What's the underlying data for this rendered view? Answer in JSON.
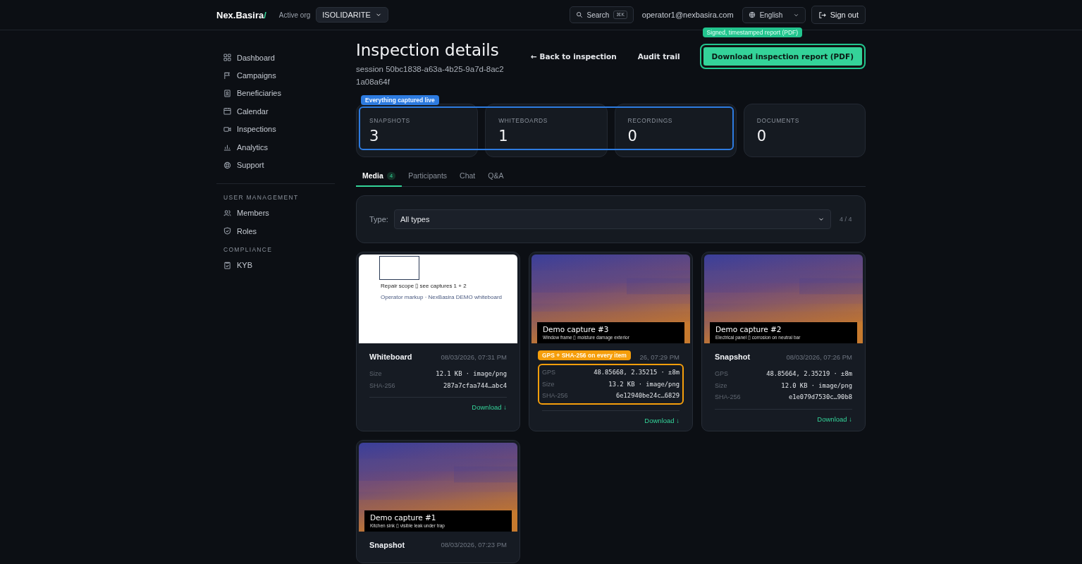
{
  "header": {
    "logo": {
      "name": "Nex.Basira",
      "mark": "/"
    },
    "org_label": "Active org",
    "org": "ISOLIDARITE",
    "search": {
      "label": "Search",
      "shortcut": "⌘K"
    },
    "user": "operator1@nexbasira.com",
    "language": "English",
    "sign_out": "Sign out"
  },
  "sidebar": {
    "items": [
      {
        "label": "Dashboard",
        "selected": false
      },
      {
        "label": "Campaigns",
        "selected": false
      },
      {
        "label": "Beneficiaries",
        "selected": false
      },
      {
        "label": "Calendar",
        "selected": false
      },
      {
        "label": "Inspections",
        "selected": false
      },
      {
        "label": "Analytics",
        "selected": false
      },
      {
        "label": "Support",
        "selected": false
      }
    ],
    "sections": [
      {
        "title": "USER MANAGEMENT",
        "items": [
          {
            "label": "Members",
            "selected": false
          },
          {
            "label": "Roles",
            "selected": false
          }
        ]
      },
      {
        "title": "COMPLIANCE",
        "items": [
          {
            "label": "KYB",
            "selected": false
          }
        ]
      }
    ]
  },
  "page": {
    "title": "Inspection details",
    "subtitle": "session 50bc1838-a63a-4b25-9a7d-8ac21a08a64f",
    "actions": {
      "back": "← Back to inspection",
      "audit": "Audit trail",
      "download": {
        "label": "Download inspection report (PDF)",
        "callout": "Signed, timestamped report (PDF)"
      }
    }
  },
  "stats": {
    "callout": "Everything captured live",
    "cards": [
      {
        "label": "SNAPSHOTS",
        "value": "3",
        "highlighted": true
      },
      {
        "label": "WHITEBOARDS",
        "value": "1",
        "highlighted": true
      },
      {
        "label": "RECORDINGS",
        "value": "0",
        "highlighted": true
      },
      {
        "label": "DOCUMENTS",
        "value": "0",
        "highlighted": false
      }
    ]
  },
  "tabs": [
    {
      "label": "Media",
      "count": "4",
      "selected": true
    },
    {
      "label": "Participants",
      "selected": false
    },
    {
      "label": "Chat",
      "selected": false
    },
    {
      "label": "Q&A",
      "selected": false
    }
  ],
  "filter": {
    "label": "Type:",
    "value": "All types",
    "count": "4 / 4"
  },
  "media": [
    {
      "kind": "whiteboard",
      "board_title": "Repair scope ▯ see captures 1 + 2",
      "board_note": "Operator markup · NexBasira DEMO whiteboard",
      "title": "Whiteboard",
      "date": "08/03/2026, 07:31 PM",
      "meta": [
        {
          "label": "Size",
          "value": "12.1 KB · image/png"
        },
        {
          "label": "SHA-256",
          "value": "287a7cfaa744…abc4"
        }
      ],
      "download": "Download ↓"
    },
    {
      "kind": "snapshot",
      "caption": "Demo capture #3",
      "subcaption": "Window frame ▯ moisture damage exterior",
      "date": "26, 07:29 PM",
      "callout": "GPS + SHA-256 on every item",
      "meta": [
        {
          "label": "GPS",
          "value": "48.85668, 2.35215 · ±8m"
        },
        {
          "label": "Size",
          "value": "13.2 KB · image/png"
        },
        {
          "label": "SHA-256",
          "value": "6e12940be24c…6829"
        }
      ],
      "download": "Download ↓"
    },
    {
      "kind": "snapshot",
      "caption": "Demo capture #2",
      "subcaption": "Electrical panel ▯ corrosion on neutral bar",
      "title": "Snapshot",
      "date": "08/03/2026, 07:26 PM",
      "meta": [
        {
          "label": "GPS",
          "value": "48.85664, 2.35219 · ±8m"
        },
        {
          "label": "Size",
          "value": "12.0 KB · image/png"
        },
        {
          "label": "SHA-256",
          "value": "e1e079d7530c…90b8"
        }
      ],
      "download": "Download ↓"
    },
    {
      "kind": "snapshot",
      "caption": "Demo capture #1",
      "subcaption": "Kitchen sink ▯ visible leak under trap",
      "title": "Snapshot",
      "date": "08/03/2026, 07:23 PM"
    }
  ]
}
